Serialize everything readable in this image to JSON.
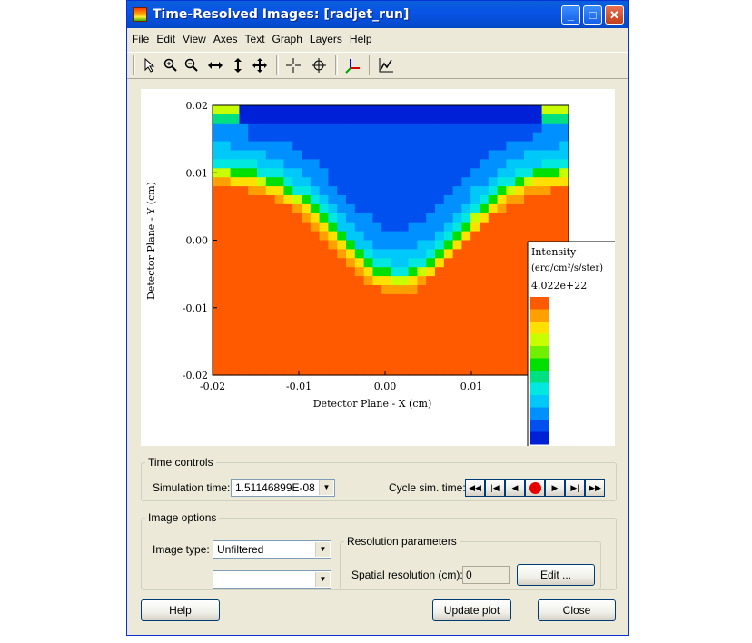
{
  "window": {
    "title": "Time-Resolved Images: [radjet_run]",
    "minimize_icon": "minimize-icon",
    "maximize_icon": "maximize-icon",
    "close_icon": "close-icon"
  },
  "menu": [
    "File",
    "Edit",
    "View",
    "Axes",
    "Text",
    "Graph",
    "Layers",
    "Help"
  ],
  "toolbar_icons": [
    "pointer-icon",
    "zoom-in-icon",
    "zoom-out-icon",
    "pan-horizontal-icon",
    "pan-vertical-icon",
    "pan-both-icon",
    "crosshair-icon",
    "target-icon",
    "axes-3d-icon",
    "line-plot-icon"
  ],
  "plot": {
    "xlabel": "Detector Plane - X (cm)",
    "ylabel": "Detector Plane - Y (cm)",
    "x_ticks": [
      "-0.02",
      "-0.01",
      "0.00",
      "0.01"
    ],
    "y_ticks": [
      "0.02",
      "0.01",
      "0.00",
      "-0.01",
      "-0.02"
    ],
    "colorbar": {
      "title": "Intensity",
      "units": "(erg/cm²/s/ster)",
      "max_label": "4.022e+22",
      "colors": [
        "#ff5a00",
        "#ffa000",
        "#ffe000",
        "#c8ff00",
        "#70f000",
        "#00e000",
        "#00e080",
        "#00e8e0",
        "#00c8f8",
        "#0090ff",
        "#0050f0",
        "#0020d8"
      ]
    }
  },
  "chart_data": {
    "type": "heatmap",
    "xlabel": "Detector Plane - X (cm)",
    "ylabel": "Detector Plane - Y (cm)",
    "xlim": [
      -0.02,
      0.0265
    ],
    "ylim": [
      -0.02,
      0.02
    ],
    "colorbar_label": "Intensity (erg/cm²/s/ster)",
    "colorbar_max": "4.022e+22"
  },
  "time_controls": {
    "legend": "Time controls",
    "sim_time_label": "Simulation time:",
    "sim_time_value": "1.51146899E-08",
    "cycle_label": "Cycle sim. time:",
    "cycle_buttons": [
      "rewind-icon",
      "first-frame-icon",
      "step-back-icon",
      "record-icon",
      "play-icon",
      "last-frame-icon",
      "fast-forward-icon"
    ]
  },
  "image_options": {
    "legend": "Image options",
    "image_type_label": "Image type:",
    "image_type_value": "Unfiltered",
    "second_select_value": "",
    "resolution": {
      "legend": "Resolution parameters",
      "spatial_label": "Spatial resolution (cm):",
      "spatial_value": "0",
      "edit_label": "Edit ..."
    }
  },
  "buttons": {
    "help": "Help",
    "update": "Update plot",
    "close": "Close"
  },
  "colors": {
    "title_bar": "#0854e6",
    "window_bg": "#ece9d8"
  }
}
